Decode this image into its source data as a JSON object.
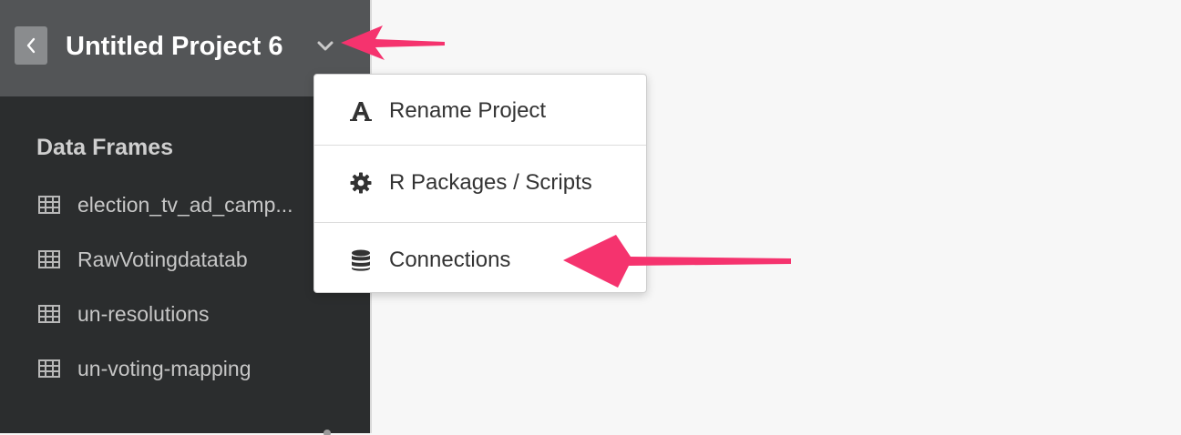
{
  "header": {
    "back_icon": "chevron-left-icon",
    "project_title": "Untitled Project 6",
    "dropdown_icon": "chevron-down-icon"
  },
  "sidebar": {
    "section_title": "Data Frames",
    "data_frames": [
      {
        "label": "election_tv_ad_camp...",
        "icon": "table-grid-icon"
      },
      {
        "label": "RawVotingdatatab",
        "icon": "table-grid-icon"
      },
      {
        "label": "un-resolutions",
        "icon": "table-grid-icon"
      },
      {
        "label": "un-voting-mapping",
        "icon": "table-grid-icon"
      }
    ]
  },
  "menu": {
    "items": [
      {
        "label": "Rename Project",
        "icon": "font-a-icon"
      },
      {
        "label": "R Packages / Scripts",
        "icon": "gear-icon"
      },
      {
        "label": "Connections",
        "icon": "database-icon"
      }
    ]
  },
  "colors": {
    "sidebar_bg": "#2b2d2e",
    "header_bg": "#535557",
    "annotation_arrow": "#f5336e",
    "page_bg": "#f7f7f7"
  }
}
